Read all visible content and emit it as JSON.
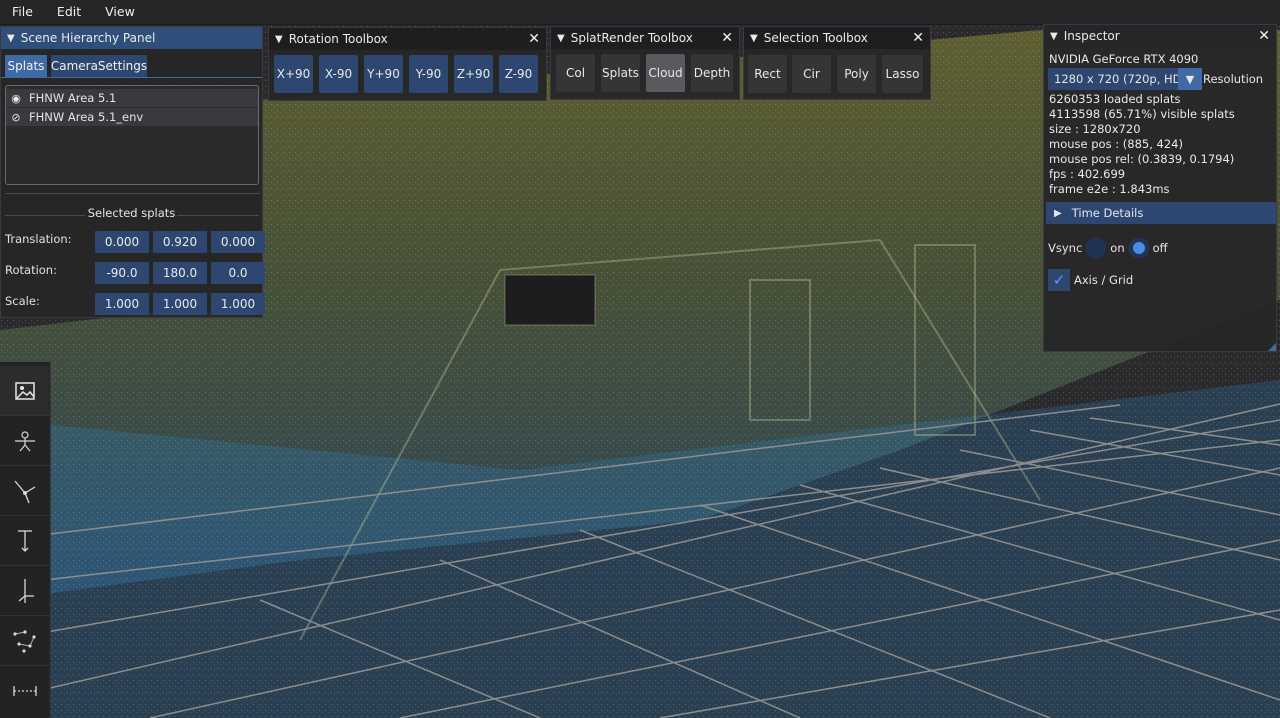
{
  "menubar": {
    "file": "File",
    "edit": "Edit",
    "view": "View"
  },
  "scene_panel": {
    "title": "Scene Hierarchy Panel",
    "tabs": [
      "Splats",
      "CameraSettings"
    ],
    "items": [
      "FHNW Area 5.1",
      "FHNW Area 5.1_env"
    ],
    "selected_header": "Selected splats",
    "translation_label": "Translation:",
    "rotation_label": "Rotation:",
    "scale_label": "Scale:",
    "translation": [
      "0.000",
      "0.920",
      "0.000"
    ],
    "rotation": [
      "-90.0",
      "180.0",
      "0.0"
    ],
    "scale": [
      "1.000",
      "1.000",
      "1.000"
    ]
  },
  "rotation_toolbox": {
    "title": "Rotation Toolbox",
    "buttons": [
      "X+90",
      "X-90",
      "Y+90",
      "Y-90",
      "Z+90",
      "Z-90"
    ]
  },
  "splatrender_toolbox": {
    "title": "SplatRender Toolbox",
    "buttons": [
      "Col",
      "Splats",
      "Cloud",
      "Depth"
    ],
    "selected": "Cloud"
  },
  "selection_toolbox": {
    "title": "Selection Toolbox",
    "buttons": [
      "Rect",
      "Cir",
      "Poly",
      "Lasso"
    ]
  },
  "inspector": {
    "title": "Inspector",
    "gpu": "NVIDIA GeForce RTX 4090",
    "resolution_value": "1280 x 720 (720p, HD)",
    "resolution_label": "Resolution",
    "loaded": "6260353 loaded splats",
    "visible": "4113598 (65.71%) visible splats",
    "size": "size     : 1280x720",
    "mouse_pos": "mouse pos    :  (885, 424)",
    "mouse_pos_rel": "mouse pos rel:  (0.3839, 0.1794)",
    "fps": "fps       : 402.699",
    "frame": "frame e2e :  1.843ms",
    "time_details": "Time Details",
    "vsync_label": "Vsync",
    "vsync_on": "on",
    "vsync_off": "off",
    "axis_grid": "Axis / Grid"
  },
  "colors": {
    "accent": "#2d4770",
    "title_active": "#2f4f7a",
    "cloud_yellow": "#d8d83a",
    "cloud_green": "#8cc05a",
    "cloud_blue": "#2f8fd8"
  },
  "left_tools": [
    "image-icon",
    "person-icon",
    "transform-icon",
    "translate-y-icon",
    "translate-axis-icon",
    "scatter-icon",
    "measure-icon"
  ]
}
